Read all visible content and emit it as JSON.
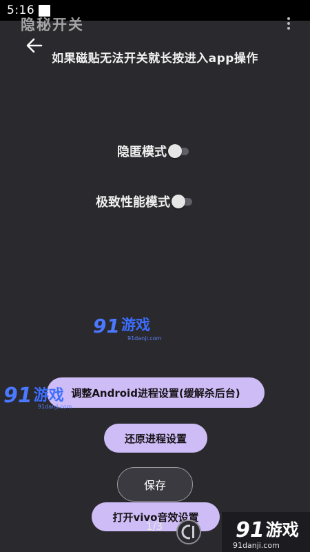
{
  "status_bar": {
    "time": "5:16"
  },
  "app_bar": {
    "title": "隐秘开关"
  },
  "hint": "如果磁贴无法开关就长按进入app操作",
  "switches": [
    {
      "label": "隐匿模式",
      "state": "off"
    },
    {
      "label": "极致性能模式",
      "state": "off"
    }
  ],
  "buttons": {
    "adjust": "调整Android进程设置(缓解杀后台)",
    "restore": "还原进程设置",
    "save": "保存",
    "vivo": "打开vivo音效设置"
  },
  "page_indicator": "1/3",
  "watermark": {
    "logo_num": "91",
    "logo_text": "游戏",
    "domain": "91danji.com"
  },
  "colors": {
    "background": "#2a292e",
    "pill": "#cebcf6",
    "watermark": "#3c6eff"
  }
}
